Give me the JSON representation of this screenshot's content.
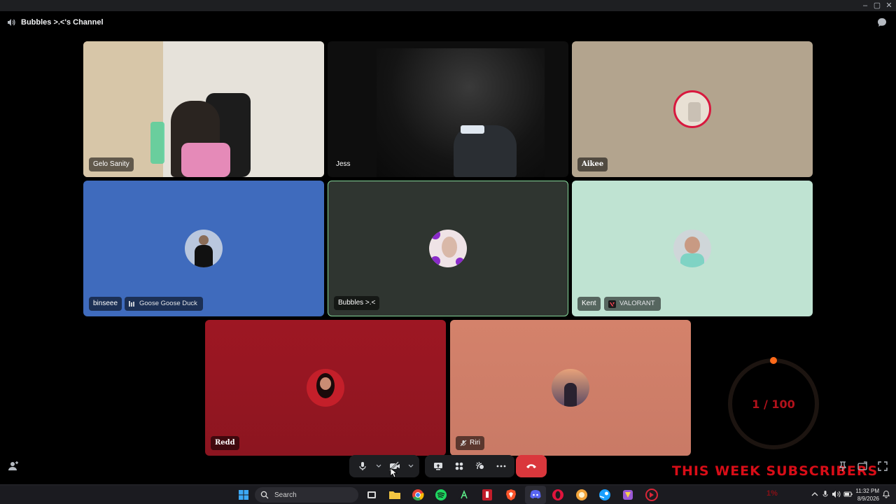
{
  "window": {
    "controls": [
      "minimize",
      "maximize",
      "close"
    ]
  },
  "channel": {
    "name": "Bubbles >.<'s Channel",
    "icon": "speaker-icon"
  },
  "tiles": [
    {
      "name": "Gelo Sanity",
      "type": "video",
      "color": "#8d7f6a"
    },
    {
      "name": "Jess",
      "type": "video",
      "color": "#121212"
    },
    {
      "name": "Aikee",
      "type": "avatar",
      "color": "#b3a48e"
    },
    {
      "name": "binseee",
      "type": "avatar",
      "color": "#3f6bbd",
      "activity": "Goose Goose Duck"
    },
    {
      "name": "Bubbles >.<",
      "type": "avatar",
      "color": "#2f3530",
      "speaking": true
    },
    {
      "name": "Kent",
      "type": "avatar",
      "color": "#bfe3d2",
      "activity": "VALORANT"
    },
    {
      "name": "Redd",
      "type": "avatar",
      "color": "#9e1723"
    },
    {
      "name": "Riri",
      "type": "avatar",
      "color": "#d4826b",
      "muted": true
    }
  ],
  "controls": {
    "items": [
      "microphone-icon",
      "chevron-down-icon",
      "camera-off-icon",
      "chevron-down-icon",
      "screen-share-icon",
      "activities-icon",
      "soundboard-icon",
      "more-icon"
    ],
    "leave": "phone-hangup-icon"
  },
  "overlay": {
    "count": "1 / 100",
    "banner": "THIS WEEK SUBSCRIBERS",
    "percent": "1%"
  },
  "taskbar": {
    "search_label": "Search",
    "time": "11:32 PM",
    "date": "8/9/2026",
    "apps": [
      "windows-icon",
      "task-view-icon",
      "file-explorer-icon",
      "chrome-icon",
      "spotify-icon",
      "app-icon",
      "app-red-icon",
      "brave-icon",
      "discord-icon",
      "opera-icon",
      "app-yellow-icon",
      "steam-icon",
      "app-purple-icon",
      "app-red-circle-icon"
    ]
  },
  "colors": {
    "speaking_border": "#86d79b",
    "leave_red": "#da373c",
    "overlay_red": "#d80d17"
  }
}
